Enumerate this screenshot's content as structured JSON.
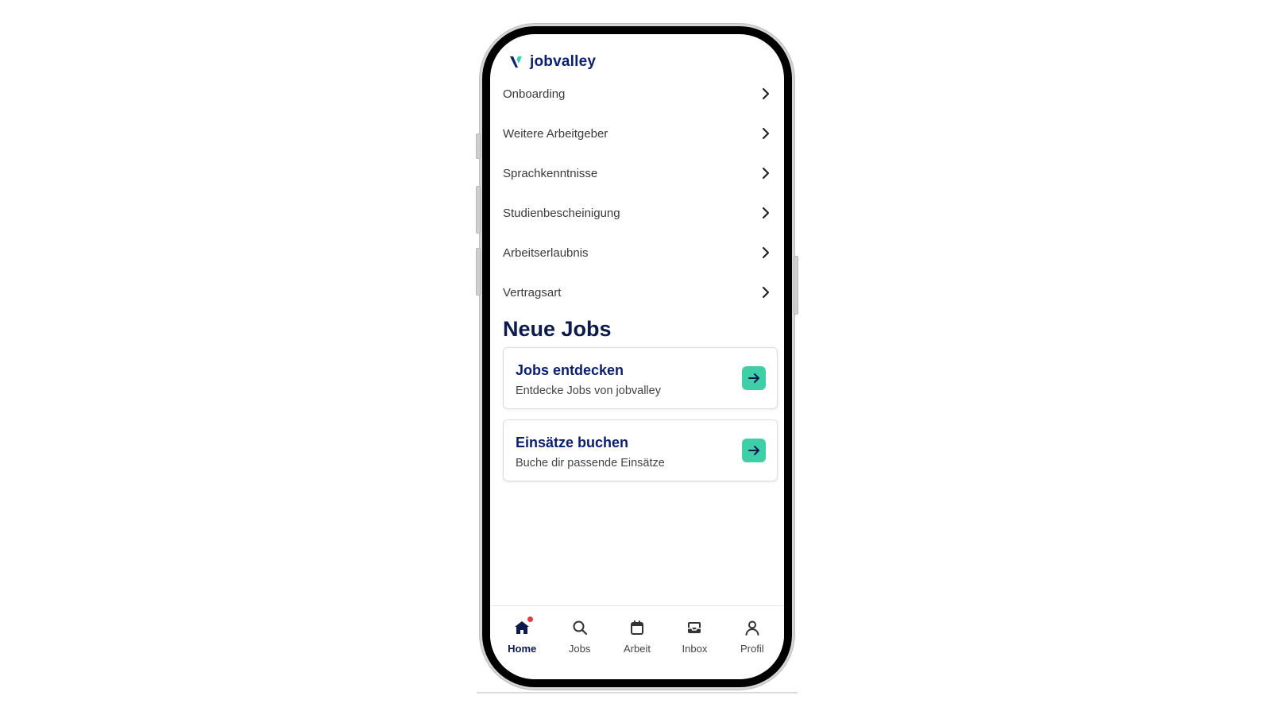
{
  "app": {
    "brand_name": "jobvalley",
    "brand_color": "#0a1e6e",
    "accent_color": "#3ecfa6"
  },
  "menu": {
    "items": [
      {
        "label": "Onboarding",
        "icon": "chevron-right-icon"
      },
      {
        "label": "Weitere Arbeitgeber",
        "icon": "chevron-right-icon"
      },
      {
        "label": "Sprachkenntnisse",
        "icon": "chevron-right-icon"
      },
      {
        "label": "Studienbescheinigung",
        "icon": "chevron-right-icon"
      },
      {
        "label": "Arbeitserlaubnis",
        "icon": "chevron-right-icon"
      },
      {
        "label": "Vertragsart",
        "icon": "chevron-right-icon"
      }
    ]
  },
  "neue_jobs": {
    "title": "Neue Jobs",
    "cards": [
      {
        "title": "Jobs entdecken",
        "subtitle": "Entdecke Jobs von jobvalley",
        "icon": "arrow-right-icon"
      },
      {
        "title": "Einsätze buchen",
        "subtitle": "Buche dir passende Einsätze",
        "icon": "arrow-right-icon"
      }
    ]
  },
  "tabbar": {
    "active": "Home",
    "items": [
      {
        "label": "Home",
        "icon": "home-icon",
        "badge": true
      },
      {
        "label": "Jobs",
        "icon": "search-icon"
      },
      {
        "label": "Arbeit",
        "icon": "calendar-icon"
      },
      {
        "label": "Inbox",
        "icon": "inbox-icon"
      },
      {
        "label": "Profil",
        "icon": "user-icon"
      }
    ]
  }
}
